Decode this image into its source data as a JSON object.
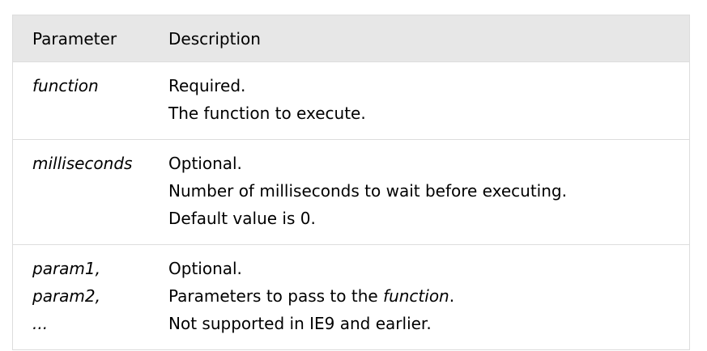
{
  "table": {
    "headers": {
      "parameter": "Parameter",
      "description": "Description"
    },
    "rows": [
      {
        "param_lines": [
          "function"
        ],
        "desc_lines": [
          "Required.",
          "The function to execute."
        ]
      },
      {
        "param_lines": [
          "milliseconds"
        ],
        "desc_lines": [
          "Optional.",
          "Number of milliseconds to wait before executing.",
          "Default value is 0."
        ]
      },
      {
        "param_lines": [
          "param1,",
          "param2,",
          "..."
        ],
        "desc_lines": [
          "Optional.",
          "Parameters to pass to the ",
          "Not supported in IE9 and earlier."
        ],
        "desc_emphasis": "function",
        "desc_emphasis_suffix": "."
      }
    ]
  }
}
